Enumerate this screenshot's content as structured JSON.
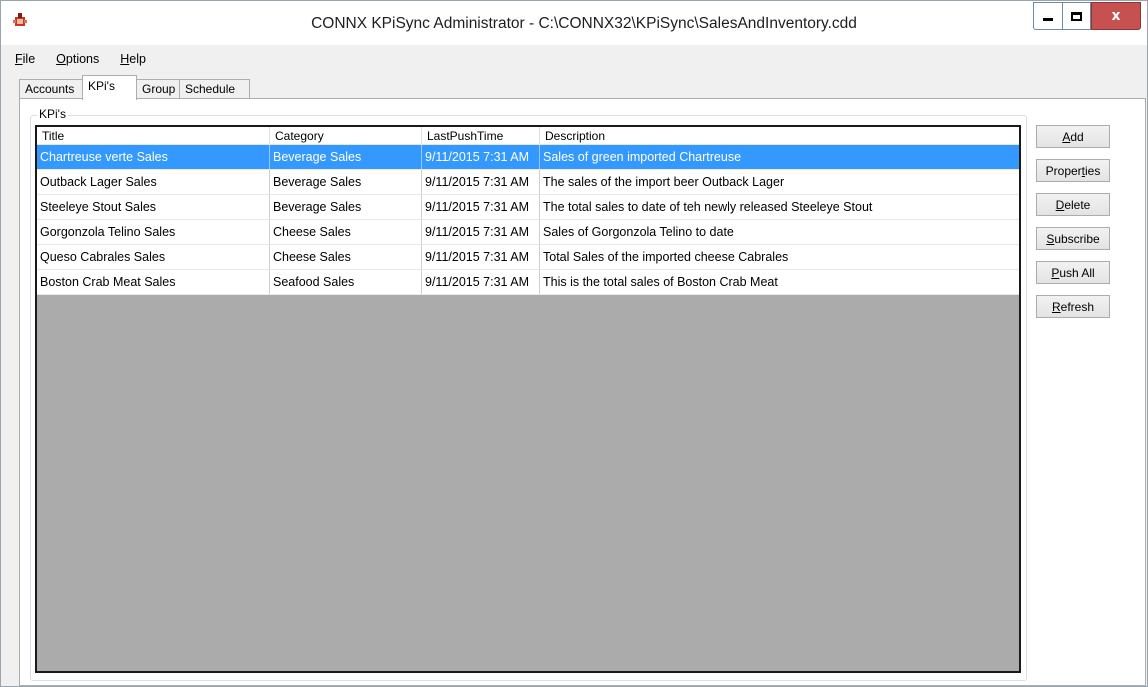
{
  "window": {
    "title": "CONNX KPiSync Administrator - C:\\CONNX32\\KPiSync\\SalesAndInventory.cdd",
    "icon": "app-icon",
    "controls": {
      "minimize_icon": "minimize-icon",
      "maximize_icon": "maximize-icon",
      "close_glyph": "x"
    }
  },
  "menu": [
    {
      "u": "F",
      "rest": "ile"
    },
    {
      "u": "O",
      "rest": "ptions"
    },
    {
      "u": "H",
      "rest": "elp"
    }
  ],
  "tabs": [
    {
      "label": "Accounts",
      "active": false
    },
    {
      "label": "KPi's",
      "active": true
    },
    {
      "label": "Group",
      "active": false
    },
    {
      "label": "Schedule",
      "active": false
    }
  ],
  "kpis": {
    "group_label": "KPi's",
    "columns": [
      "Title",
      "Category",
      "LastPushTime",
      "Description"
    ],
    "rows": [
      [
        "Chartreuse verte Sales",
        "Beverage Sales",
        "9/11/2015 7:31 AM",
        "Sales of green imported Chartreuse"
      ],
      [
        "Outback Lager Sales",
        "Beverage Sales",
        "9/11/2015 7:31 AM",
        "The sales of the import beer Outback Lager"
      ],
      [
        "Steeleye Stout Sales",
        "Beverage Sales",
        "9/11/2015 7:31 AM",
        "The total sales to date of teh newly released Steeleye Stout"
      ],
      [
        "Gorgonzola Telino Sales",
        "Cheese Sales",
        "9/11/2015 7:31 AM",
        "Sales of Gorgonzola Telino to date"
      ],
      [
        "Queso Cabrales Sales",
        "Cheese Sales",
        "9/11/2015 7:31 AM",
        "Total Sales of the imported cheese Cabrales"
      ],
      [
        "Boston Crab Meat Sales",
        "Seafood Sales",
        "9/11/2015 7:31 AM",
        "This is the total sales of Boston Crab Meat"
      ]
    ],
    "selected_row": 0
  },
  "buttons": [
    {
      "name": "add-button",
      "pre": "",
      "u": "A",
      "post": "dd"
    },
    {
      "name": "properties-button",
      "pre": "Proper",
      "u": "t",
      "post": "ies"
    },
    {
      "name": "delete-button",
      "pre": "",
      "u": "D",
      "post": "elete"
    },
    {
      "name": "subscribe-button",
      "pre": "",
      "u": "S",
      "post": "ubscribe"
    },
    {
      "name": "push-all-button",
      "pre": "",
      "u": "P",
      "post": "ush All"
    },
    {
      "name": "refresh-button",
      "pre": "",
      "u": "R",
      "post": "efresh"
    }
  ],
  "colors": {
    "selection": "#3399ff",
    "close_button": "#c75050",
    "list_background": "#ababab"
  }
}
